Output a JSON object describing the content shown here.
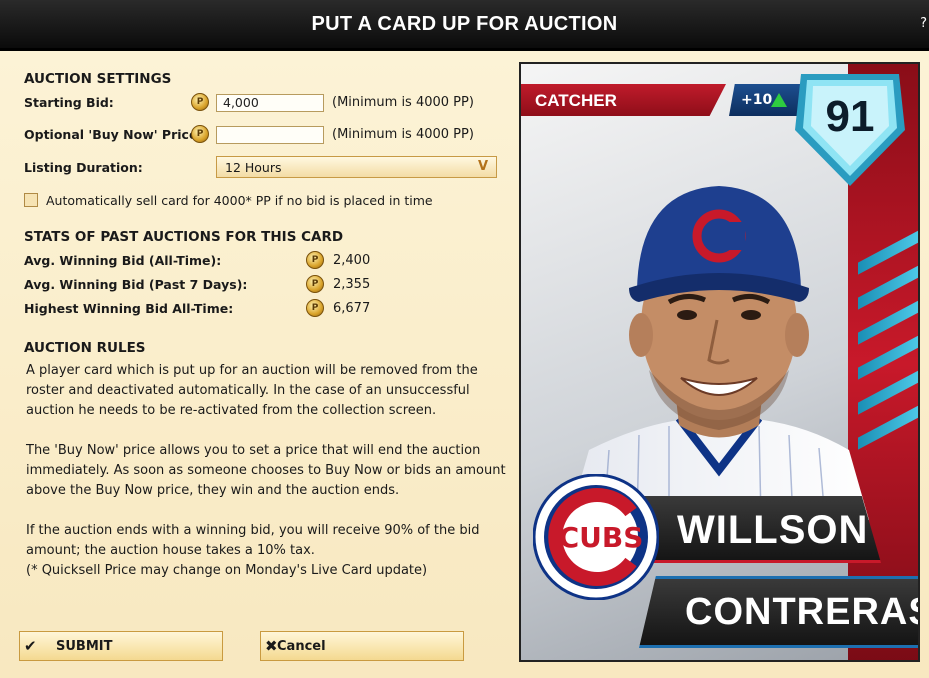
{
  "window": {
    "title": "PUT A CARD UP FOR AUCTION",
    "close_label": "?"
  },
  "auction_settings": {
    "heading": "AUCTION SETTINGS",
    "starting_bid_label": "Starting Bid:",
    "starting_bid_value": "4,000",
    "starting_bid_min": "(Minimum is 4000 PP)",
    "buy_now_label": "Optional 'Buy Now' Price:",
    "buy_now_value": "",
    "buy_now_min": "(Minimum is 4000 PP)",
    "duration_label": "Listing Duration:",
    "duration_value": "12 Hours",
    "auto_sell_label": "Automatically sell card for 4000* PP if no bid is placed in time",
    "auto_sell_checked": false
  },
  "stats": {
    "heading": "STATS OF PAST AUCTIONS FOR THIS CARD",
    "rows": [
      {
        "label": "Avg. Winning Bid (All-Time):",
        "value": "2,400"
      },
      {
        "label": "Avg. Winning Bid (Past 7 Days):",
        "value": "2,355"
      },
      {
        "label": "Highest Winning Bid All-Time:",
        "value": "6,677"
      }
    ]
  },
  "rules": {
    "heading": "AUCTION RULES",
    "p1_l1": "A player card which is put up for an auction will be removed from the",
    "p1_l2": "roster and deactivated automatically. In the case of an unsuccessful",
    "p1_l3": "auction he needs to be re-activated from the collection screen.",
    "p2_l1": "The 'Buy Now' price allows you to set a price that will end the auction",
    "p2_l2": "immediately. As soon as someone chooses to Buy Now or bids an amount",
    "p2_l3": "above the Buy Now price, they win and the auction ends.",
    "p3_l1": "If the auction ends with a winning bid, you will receive 90% of the bid",
    "p3_l2": "amount; the auction house takes a 10% tax.",
    "p3_l3": "(* Quicksell Price may change on Monday's Live Card update)"
  },
  "buttons": {
    "submit": "SUBMIT",
    "cancel": "Cancel"
  },
  "card": {
    "position": "CATCHER",
    "boost": "+10",
    "overall": "91",
    "first_name": "WILLSON",
    "last_name": "CONTRERAS",
    "team_logo_text": "CUBS",
    "cap_letter": "C",
    "colors": {
      "red": "#c8192a",
      "blue": "#0e3386",
      "diamond": "#4ec9e3"
    }
  },
  "coin_symbol": "P"
}
